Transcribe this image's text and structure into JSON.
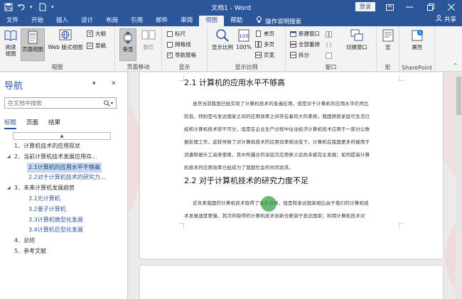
{
  "window": {
    "title": "文档1 - Word",
    "login_label": "登录",
    "share_label": "共享",
    "search_label": "操作说明搜索"
  },
  "tabs": [
    "文件",
    "开始",
    "插入",
    "设计",
    "布局",
    "引用",
    "邮件",
    "审阅",
    "视图",
    "帮助"
  ],
  "active_tab": "视图",
  "ribbon": {
    "groups": {
      "view": "视图",
      "page_move": "页面移动",
      "show": "显示",
      "zoom": "显示比例",
      "window": "窗口",
      "macro": "宏",
      "sharepoint": "SharePoint"
    },
    "buttons": {
      "read_mode": "阅读\n视图",
      "print_layout": "页面视图",
      "web_layout": "Web 版式视图",
      "outline": "大纲",
      "draft": "草稿",
      "vertical": "垂直",
      "side_to_side": "翻页",
      "ruler": "标尺",
      "gridlines": "网格线",
      "nav_pane": "导航窗格",
      "zoom": "显示比例",
      "zoom_100": "100%",
      "one_page": "单页",
      "multi_page": "多页",
      "page_width": "页宽",
      "new_window": "新建窗口",
      "arrange_all": "全部重排",
      "split": "拆分",
      "switch_window": "切换窗口",
      "macros": "宏",
      "properties": "属性"
    },
    "checkboxes": {
      "ruler": false,
      "gridlines": false,
      "nav_pane": true
    }
  },
  "nav": {
    "title": "导航",
    "search_placeholder": "在文档中搜索",
    "tabs": [
      "标题",
      "页面",
      "结果"
    ],
    "active_tab": "标题",
    "items": [
      {
        "label": "1．计算机技术的应用现状",
        "level": 1,
        "expander": ""
      },
      {
        "label": "2．当前计算机技术发展应用存...",
        "level": 1,
        "expander": "◢"
      },
      {
        "label": "2.1计算机的应用水平不够高",
        "level": 2,
        "expander": "",
        "selected": true
      },
      {
        "label": "2.2对于计算机技术的研究力...",
        "level": 2,
        "expander": ""
      },
      {
        "label": "3．未来计算机发展趋势",
        "level": 1,
        "expander": "◢"
      },
      {
        "label": "3.1光计算机",
        "level": 2,
        "expander": ""
      },
      {
        "label": "3.2量子计算机",
        "level": 2,
        "expander": ""
      },
      {
        "label": "3.3计算机微型化发展",
        "level": 2,
        "expander": ""
      },
      {
        "label": "3.4计算机巨型化发展",
        "level": 2,
        "expander": ""
      },
      {
        "label": "4．总结",
        "level": 1,
        "expander": ""
      },
      {
        "label": "5．参考文献",
        "level": 1,
        "expander": ""
      }
    ]
  },
  "doc": {
    "heading1": "2.1 计算机的应用水平不够高",
    "para1": [
      "虽然当前我国已经实现了计算机技术的普遍应用，但是对于计算机的应用水平仍然比",
      "较低，特别是与发达国家之间的应用效率之间存在着较大的差距。我国居民家庭代生活已",
      "经和计算机技术密不可分，但是在企业生产过程中往往经济计算机技术应用于一部分公数",
      "据处理工作，这就导致了对计算机技术的应用效率相当低下。计算机在我国更多的被用于",
      "消遣和娱乐工具来使用，其中所蕴含的深层次应用意义远尚未被完全发掘；如何提高计算",
      "机技术的应用效率已经成为了我国社会的共同追求。"
    ],
    "heading2": "2.2 对于计算机技术的研究力度不足",
    "para2": [
      "近年来我国的计算机技术取得了诸多进展，但是和发达国家相比由于我们的计算机技",
      "术发展速度要慢，其次所取得的计算机技术创新也要弱于发达国家；利用计算机技术对"
    ]
  },
  "colors": {
    "accent": "#2b579a",
    "selection": "#c6d9ef",
    "cursor": "#3ca046"
  }
}
